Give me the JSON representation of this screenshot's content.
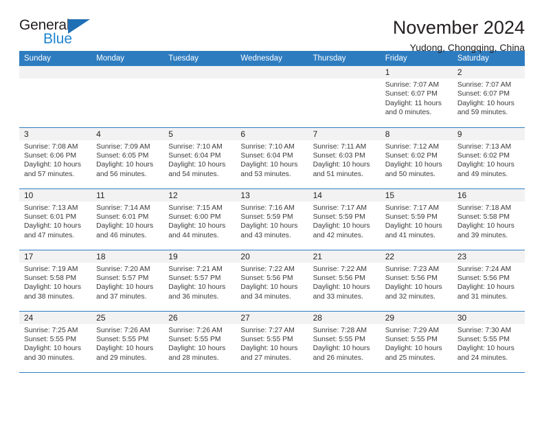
{
  "brand": {
    "word1": "General",
    "word2": "Blue",
    "logo_icon": "triangle-logo-icon",
    "accent_color": "#1f83d0"
  },
  "header": {
    "title": "November 2024",
    "subtitle": "Yudong, Chongqing, China"
  },
  "calendar": {
    "header_color": "#2e7cc0",
    "weekday_headers": [
      "Sunday",
      "Monday",
      "Tuesday",
      "Wednesday",
      "Thursday",
      "Friday",
      "Saturday"
    ],
    "labels": {
      "sunrise": "Sunrise:",
      "sunset": "Sunset:",
      "daylight": "Daylight:"
    },
    "weeks": [
      [
        {
          "day": "",
          "empty": true
        },
        {
          "day": "",
          "empty": true
        },
        {
          "day": "",
          "empty": true
        },
        {
          "day": "",
          "empty": true
        },
        {
          "day": "",
          "empty": true
        },
        {
          "day": "1",
          "sunrise": "Sunrise: 7:07 AM",
          "sunset": "Sunset: 6:07 PM",
          "daylight_l1": "Daylight: 11 hours",
          "daylight_l2": "and 0 minutes."
        },
        {
          "day": "2",
          "sunrise": "Sunrise: 7:07 AM",
          "sunset": "Sunset: 6:07 PM",
          "daylight_l1": "Daylight: 10 hours",
          "daylight_l2": "and 59 minutes."
        }
      ],
      [
        {
          "day": "3",
          "sunrise": "Sunrise: 7:08 AM",
          "sunset": "Sunset: 6:06 PM",
          "daylight_l1": "Daylight: 10 hours",
          "daylight_l2": "and 57 minutes."
        },
        {
          "day": "4",
          "sunrise": "Sunrise: 7:09 AM",
          "sunset": "Sunset: 6:05 PM",
          "daylight_l1": "Daylight: 10 hours",
          "daylight_l2": "and 56 minutes."
        },
        {
          "day": "5",
          "sunrise": "Sunrise: 7:10 AM",
          "sunset": "Sunset: 6:04 PM",
          "daylight_l1": "Daylight: 10 hours",
          "daylight_l2": "and 54 minutes."
        },
        {
          "day": "6",
          "sunrise": "Sunrise: 7:10 AM",
          "sunset": "Sunset: 6:04 PM",
          "daylight_l1": "Daylight: 10 hours",
          "daylight_l2": "and 53 minutes."
        },
        {
          "day": "7",
          "sunrise": "Sunrise: 7:11 AM",
          "sunset": "Sunset: 6:03 PM",
          "daylight_l1": "Daylight: 10 hours",
          "daylight_l2": "and 51 minutes."
        },
        {
          "day": "8",
          "sunrise": "Sunrise: 7:12 AM",
          "sunset": "Sunset: 6:02 PM",
          "daylight_l1": "Daylight: 10 hours",
          "daylight_l2": "and 50 minutes."
        },
        {
          "day": "9",
          "sunrise": "Sunrise: 7:13 AM",
          "sunset": "Sunset: 6:02 PM",
          "daylight_l1": "Daylight: 10 hours",
          "daylight_l2": "and 49 minutes."
        }
      ],
      [
        {
          "day": "10",
          "sunrise": "Sunrise: 7:13 AM",
          "sunset": "Sunset: 6:01 PM",
          "daylight_l1": "Daylight: 10 hours",
          "daylight_l2": "and 47 minutes."
        },
        {
          "day": "11",
          "sunrise": "Sunrise: 7:14 AM",
          "sunset": "Sunset: 6:01 PM",
          "daylight_l1": "Daylight: 10 hours",
          "daylight_l2": "and 46 minutes."
        },
        {
          "day": "12",
          "sunrise": "Sunrise: 7:15 AM",
          "sunset": "Sunset: 6:00 PM",
          "daylight_l1": "Daylight: 10 hours",
          "daylight_l2": "and 44 minutes."
        },
        {
          "day": "13",
          "sunrise": "Sunrise: 7:16 AM",
          "sunset": "Sunset: 5:59 PM",
          "daylight_l1": "Daylight: 10 hours",
          "daylight_l2": "and 43 minutes."
        },
        {
          "day": "14",
          "sunrise": "Sunrise: 7:17 AM",
          "sunset": "Sunset: 5:59 PM",
          "daylight_l1": "Daylight: 10 hours",
          "daylight_l2": "and 42 minutes."
        },
        {
          "day": "15",
          "sunrise": "Sunrise: 7:17 AM",
          "sunset": "Sunset: 5:59 PM",
          "daylight_l1": "Daylight: 10 hours",
          "daylight_l2": "and 41 minutes."
        },
        {
          "day": "16",
          "sunrise": "Sunrise: 7:18 AM",
          "sunset": "Sunset: 5:58 PM",
          "daylight_l1": "Daylight: 10 hours",
          "daylight_l2": "and 39 minutes."
        }
      ],
      [
        {
          "day": "17",
          "sunrise": "Sunrise: 7:19 AM",
          "sunset": "Sunset: 5:58 PM",
          "daylight_l1": "Daylight: 10 hours",
          "daylight_l2": "and 38 minutes."
        },
        {
          "day": "18",
          "sunrise": "Sunrise: 7:20 AM",
          "sunset": "Sunset: 5:57 PM",
          "daylight_l1": "Daylight: 10 hours",
          "daylight_l2": "and 37 minutes."
        },
        {
          "day": "19",
          "sunrise": "Sunrise: 7:21 AM",
          "sunset": "Sunset: 5:57 PM",
          "daylight_l1": "Daylight: 10 hours",
          "daylight_l2": "and 36 minutes."
        },
        {
          "day": "20",
          "sunrise": "Sunrise: 7:22 AM",
          "sunset": "Sunset: 5:56 PM",
          "daylight_l1": "Daylight: 10 hours",
          "daylight_l2": "and 34 minutes."
        },
        {
          "day": "21",
          "sunrise": "Sunrise: 7:22 AM",
          "sunset": "Sunset: 5:56 PM",
          "daylight_l1": "Daylight: 10 hours",
          "daylight_l2": "and 33 minutes."
        },
        {
          "day": "22",
          "sunrise": "Sunrise: 7:23 AM",
          "sunset": "Sunset: 5:56 PM",
          "daylight_l1": "Daylight: 10 hours",
          "daylight_l2": "and 32 minutes."
        },
        {
          "day": "23",
          "sunrise": "Sunrise: 7:24 AM",
          "sunset": "Sunset: 5:56 PM",
          "daylight_l1": "Daylight: 10 hours",
          "daylight_l2": "and 31 minutes."
        }
      ],
      [
        {
          "day": "24",
          "sunrise": "Sunrise: 7:25 AM",
          "sunset": "Sunset: 5:55 PM",
          "daylight_l1": "Daylight: 10 hours",
          "daylight_l2": "and 30 minutes."
        },
        {
          "day": "25",
          "sunrise": "Sunrise: 7:26 AM",
          "sunset": "Sunset: 5:55 PM",
          "daylight_l1": "Daylight: 10 hours",
          "daylight_l2": "and 29 minutes."
        },
        {
          "day": "26",
          "sunrise": "Sunrise: 7:26 AM",
          "sunset": "Sunset: 5:55 PM",
          "daylight_l1": "Daylight: 10 hours",
          "daylight_l2": "and 28 minutes."
        },
        {
          "day": "27",
          "sunrise": "Sunrise: 7:27 AM",
          "sunset": "Sunset: 5:55 PM",
          "daylight_l1": "Daylight: 10 hours",
          "daylight_l2": "and 27 minutes."
        },
        {
          "day": "28",
          "sunrise": "Sunrise: 7:28 AM",
          "sunset": "Sunset: 5:55 PM",
          "daylight_l1": "Daylight: 10 hours",
          "daylight_l2": "and 26 minutes."
        },
        {
          "day": "29",
          "sunrise": "Sunrise: 7:29 AM",
          "sunset": "Sunset: 5:55 PM",
          "daylight_l1": "Daylight: 10 hours",
          "daylight_l2": "and 25 minutes."
        },
        {
          "day": "30",
          "sunrise": "Sunrise: 7:30 AM",
          "sunset": "Sunset: 5:55 PM",
          "daylight_l1": "Daylight: 10 hours",
          "daylight_l2": "and 24 minutes."
        }
      ]
    ]
  }
}
